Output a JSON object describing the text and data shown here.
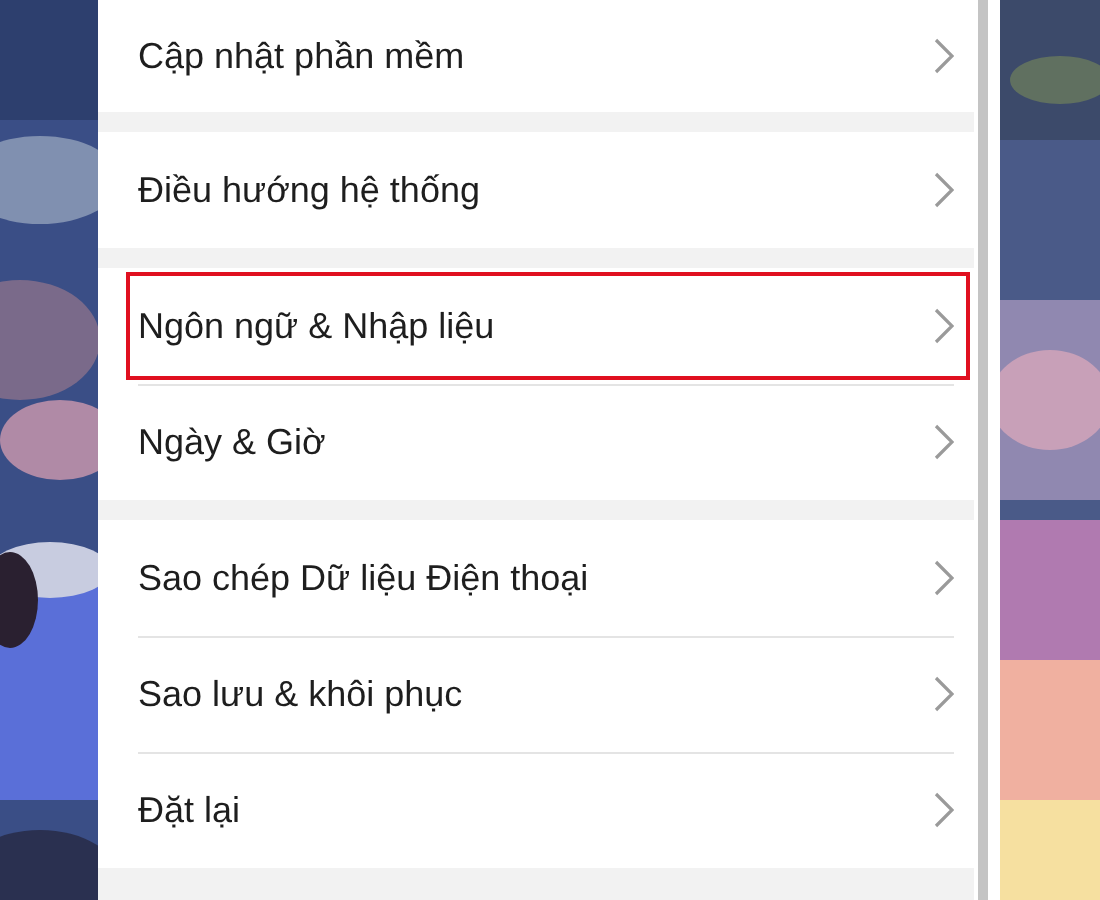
{
  "groups": [
    {
      "items": [
        {
          "label": "Cập nhật phần mềm",
          "highlighted": false
        }
      ]
    },
    {
      "items": [
        {
          "label": "Điều hướng hệ thống",
          "highlighted": false
        }
      ]
    },
    {
      "items": [
        {
          "label": "Ngôn ngữ & Nhập liệu",
          "highlighted": true
        },
        {
          "label": "Ngày & Giờ",
          "highlighted": false
        }
      ]
    },
    {
      "items": [
        {
          "label": "Sao chép Dữ liệu Điện thoại",
          "highlighted": false
        },
        {
          "label": "Sao lưu & khôi phục",
          "highlighted": false
        },
        {
          "label": "Đặt lại",
          "highlighted": false
        }
      ]
    }
  ]
}
